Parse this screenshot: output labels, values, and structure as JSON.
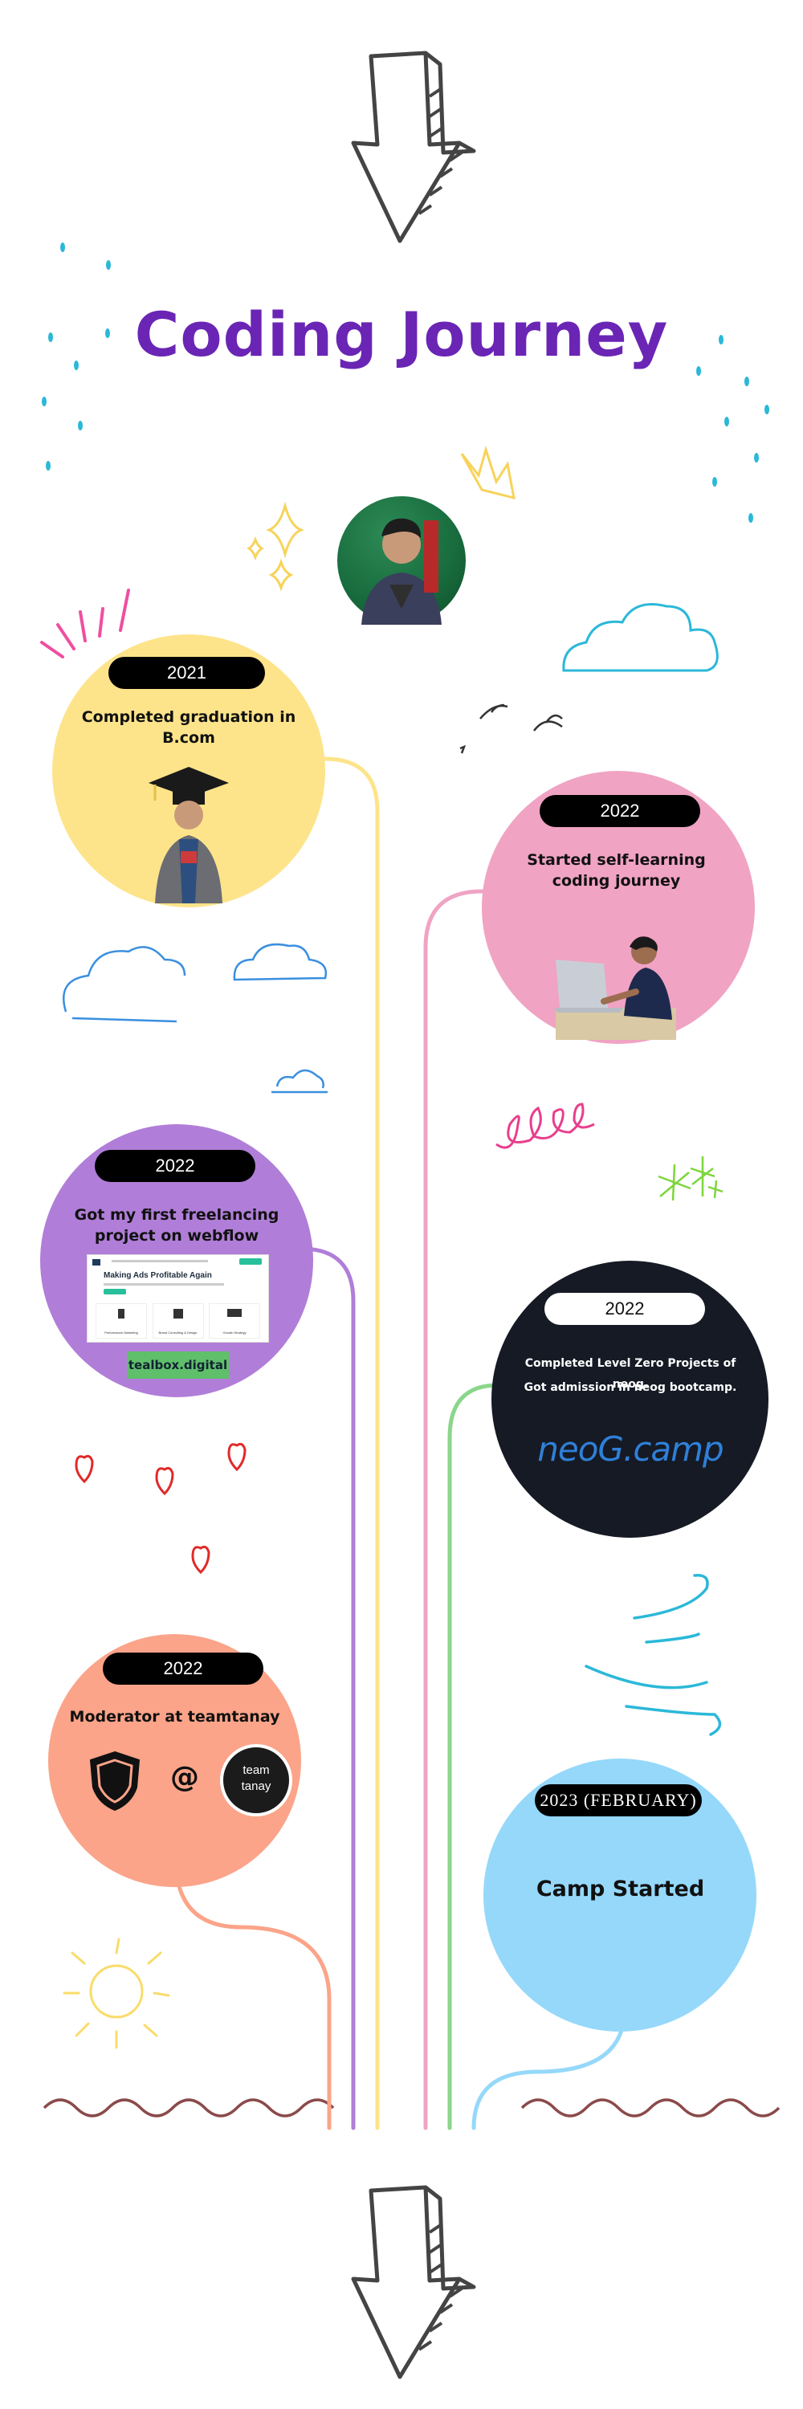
{
  "title": "Coding Journey",
  "milestones": [
    {
      "year": "2021",
      "text": "Completed graduation in B.com",
      "color": "#fde48a"
    },
    {
      "year": "2022",
      "text": "Started self-learning coding journey",
      "color": "#f0a3c3"
    },
    {
      "year": "2022",
      "text": "Got my first freelancing project on webflow",
      "color": "#b07ed8",
      "link_label": "tealbox.digital",
      "preview": {
        "heading": "Making Ads Profitable Again",
        "cards": [
          "Performance Marketing",
          "Brand Consulting & Design",
          "Growth Strategy"
        ]
      }
    },
    {
      "year": "2022",
      "line1": "Completed Level Zero Projects of neog.",
      "line2": "Got admission in neog  bootcamp.",
      "logo": "neoG.camp",
      "color": "#151a24"
    },
    {
      "year": "2022",
      "text": "Moderator at teamtanay",
      "at_symbol": "@",
      "badge_line1": "team",
      "badge_line2": "tanay",
      "color": "#fba489"
    },
    {
      "year": "2023 (FEBRUARY)",
      "text": "Camp Started",
      "color": "#95d8fa"
    }
  ],
  "icons": [
    "arrow-down-icon",
    "graduation-cap-icon",
    "laptop-icon",
    "shield-icon",
    "heart-icon",
    "cloud-icon",
    "sun-icon",
    "crown-icon",
    "sparkle-icon",
    "wind-icon",
    "bird-icon",
    "rain-drop-icon"
  ]
}
